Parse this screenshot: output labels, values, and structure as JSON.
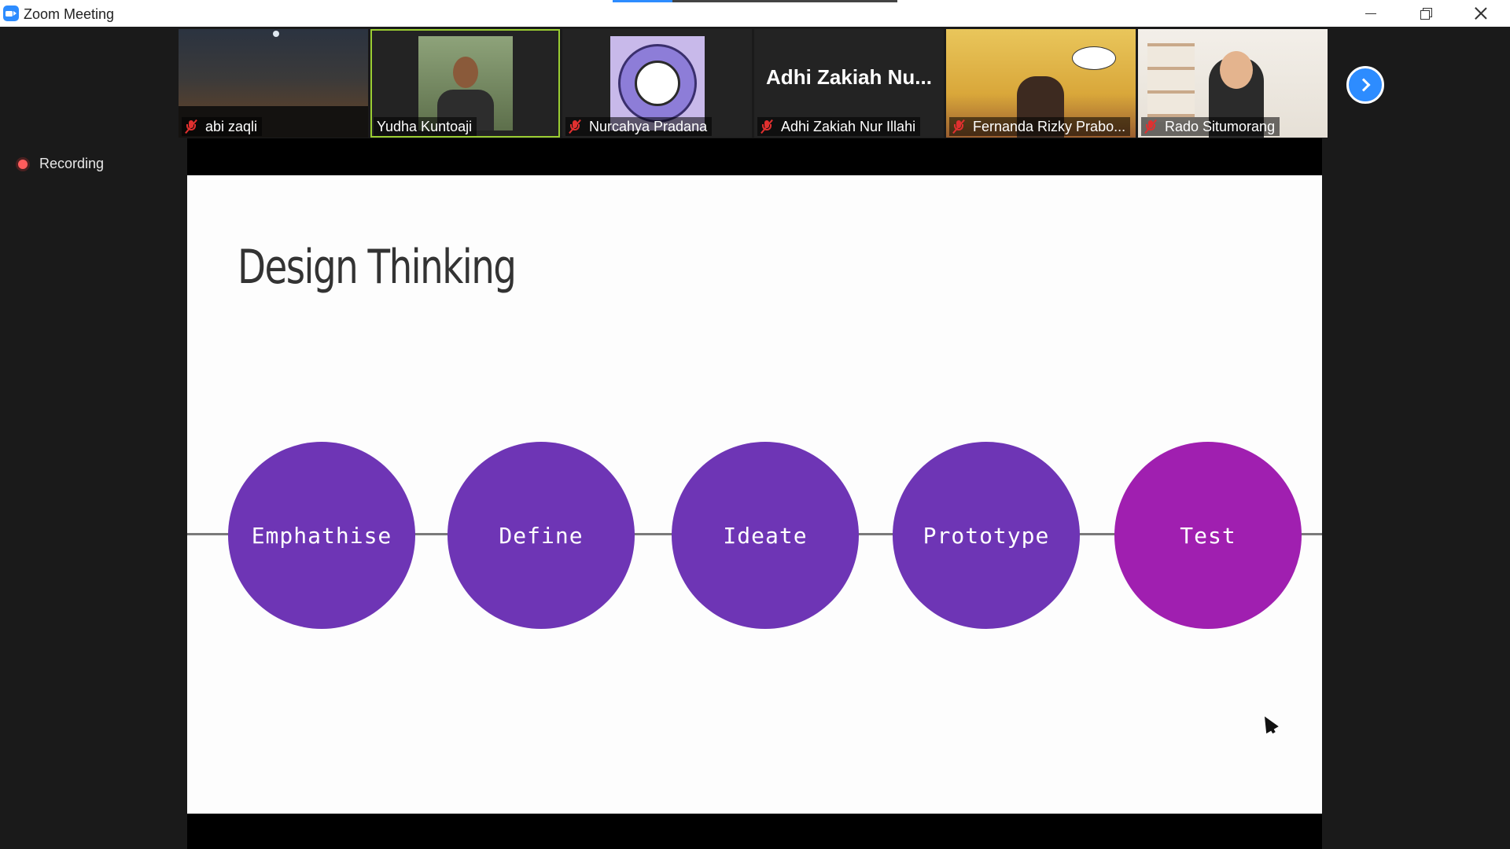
{
  "window": {
    "title": "Zoom Meeting",
    "share_progress": 0.21
  },
  "participants": [
    {
      "name": "abi zaqli",
      "muted": true,
      "active": false
    },
    {
      "name": "Yudha Kuntoaji",
      "muted": false,
      "active": true
    },
    {
      "name": "Nurcahya Pradana",
      "muted": true,
      "active": false
    },
    {
      "name": "Adhi Zakiah Nur Illahi",
      "display_name": "Adhi Zakiah Nu...",
      "muted": true,
      "active": false
    },
    {
      "name": "Fernanda Rizky Prabo...",
      "muted": true,
      "active": false
    },
    {
      "name": "Rado Situmorang",
      "muted": true,
      "active": false
    }
  ],
  "recording": {
    "label": "Recording"
  },
  "slide": {
    "title": "Design Thinking",
    "steps": [
      {
        "label": "Emphathise",
        "color": "#6e35b5"
      },
      {
        "label": "Define",
        "color": "#6e35b5"
      },
      {
        "label": "Ideate",
        "color": "#6e35b5"
      },
      {
        "label": "Prototype",
        "color": "#6e35b5"
      },
      {
        "label": "Test",
        "color": "#a01fb0"
      }
    ],
    "connector_color": "#7a7a7a"
  },
  "colors": {
    "accent": "#2d8cff",
    "active_speaker": "#9acd32",
    "muted": "#e0302f",
    "recording": "#ff5c5c"
  },
  "icons": {
    "app": "zoom-camera-icon",
    "mute": "muted-mic-icon",
    "next": "chevron-right-icon",
    "recording": "record-dot-icon"
  }
}
